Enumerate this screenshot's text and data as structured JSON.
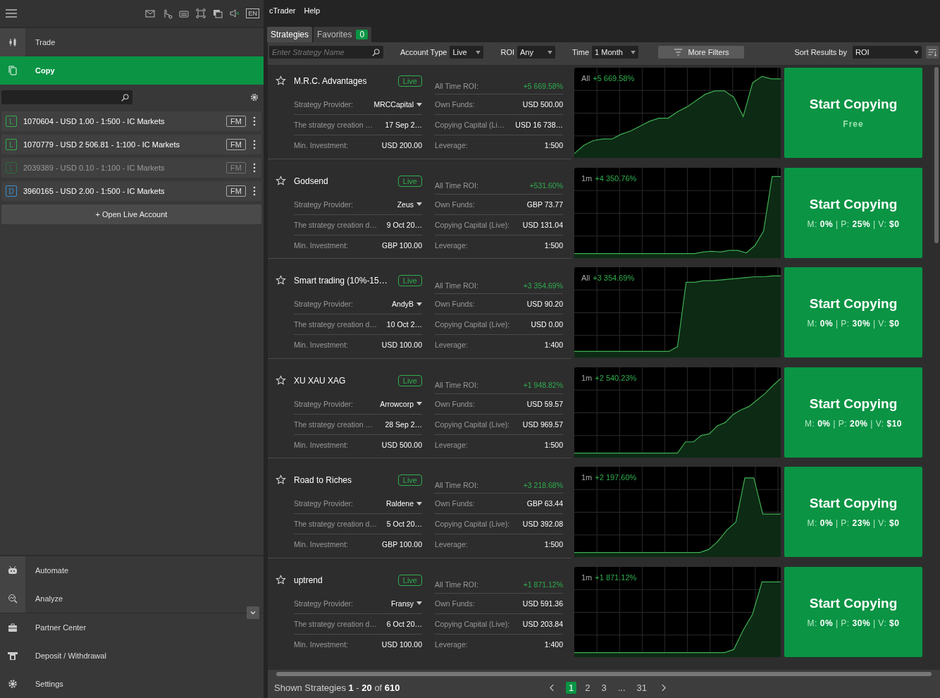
{
  "sidebar": {
    "top_nav": [
      {
        "label": "Trade",
        "selected": false
      },
      {
        "label": "Copy",
        "selected": true
      }
    ],
    "accounts": [
      {
        "type": "L",
        "color": "#2fae4e",
        "label": "1070604 - USD 1.00 - 1:500 - IC Markets",
        "badge": "FM",
        "disabled": false
      },
      {
        "type": "L",
        "color": "#2fae4e",
        "label": "1070779 - USD 2 506.81 - 1:100 - IC Markets",
        "badge": "FM",
        "disabled": false
      },
      {
        "type": "L",
        "color": "#2a6b3a",
        "label": "2039389 - USD 0.10 - 1:100 - IC Markets",
        "badge": "FM",
        "disabled": true
      },
      {
        "type": "D",
        "color": "#3a8fd0",
        "label": "3960165 - USD 2.00 - 1:500 - IC Markets",
        "badge": "FM",
        "disabled": false
      }
    ],
    "open_account": "+ Open Live Account",
    "bottom_nav": [
      {
        "label": "Automate",
        "selected": false
      },
      {
        "label": "Analyze",
        "selected": false
      },
      {
        "label": "Partner Center",
        "selected": false
      },
      {
        "label": "Deposit / Withdrawal",
        "selected": false
      },
      {
        "label": "Settings",
        "selected": false
      }
    ],
    "language": "EN"
  },
  "menu": [
    "cTrader",
    "Help"
  ],
  "tabs": [
    {
      "label": "Strategies",
      "selected": true
    },
    {
      "label": "Favorites",
      "selected": false,
      "count": "0"
    }
  ],
  "filters": {
    "search": {
      "placeholder": "Enter Strategy Name"
    },
    "selects": [
      {
        "label": "Account Type",
        "value": "Live"
      },
      {
        "label": "ROI",
        "value": "Any"
      },
      {
        "label": "Time",
        "value": "1 Month"
      }
    ],
    "more": "More Filters",
    "sort_label": "Sort Results by",
    "sort_value": "ROI"
  },
  "strategies": [
    {
      "name": "M.R.C. Advantages",
      "badge": "Live",
      "provider_label": "Strategy Provider:",
      "provider": "MRCCapital",
      "creation_label": "The strategy creation …",
      "creation": "17 Sep 2…",
      "min_label": "Min. Investment:",
      "min": "USD 200.00",
      "roi_label": "All Time ROI:",
      "roi": "+5 669.58%",
      "funds_label": "Own Funds:",
      "funds": "USD 500.00",
      "capital_label": "Copying Capital (Li…",
      "capital": "USD 16 738…",
      "leverage_label": "Leverage:",
      "leverage": "1:500",
      "period": "All",
      "period_roi": "+5 669.58%",
      "button": "Start Copying",
      "kind": "free",
      "fee": "Free"
    },
    {
      "name": "Godsend",
      "badge": "Live",
      "provider_label": "Strategy Provider:",
      "provider": "Zeus",
      "creation_label": "The strategy creation d…",
      "creation": "9 Oct 20…",
      "min_label": "Min. Investment:",
      "min": "GBP 100.00",
      "roi_label": "All Time ROI:",
      "roi": "+531.60%",
      "funds_label": "Own Funds:",
      "funds": "GBP 73.77",
      "capital_label": "Copying Capital (Live):",
      "capital": "USD 131.04",
      "leverage_label": "Leverage:",
      "leverage": "1:500",
      "period": "1m",
      "period_roi": "+4 350.76%",
      "button": "Start Copying",
      "kind": "fees",
      "fee": "M: **0%** | P: **25%** | V: **$0**"
    },
    {
      "name": "Smart trading (10%-15…",
      "badge": "Live",
      "provider_label": "Strategy Provider:",
      "provider": "AndyB",
      "creation_label": "The strategy creation d…",
      "creation": "10 Oct 2…",
      "min_label": "Min. Investment:",
      "min": "USD 100.00",
      "roi_label": "All Time ROI:",
      "roi": "+3 354.69%",
      "funds_label": "Own Funds:",
      "funds": "USD 90.20",
      "capital_label": "Copying Capital (Live):",
      "capital": "USD 0.00",
      "leverage_label": "Leverage:",
      "leverage": "1:400",
      "period": "All",
      "period_roi": "+3 354.69%",
      "button": "Start Copying",
      "kind": "fees",
      "fee": "M: **0%** | P: **30%** | V: **$0**"
    },
    {
      "name": "XU XAU XAG",
      "badge": "Live",
      "provider_label": "Strategy Provider:",
      "provider": "Arrowcorp",
      "creation_label": "The strategy creation …",
      "creation": "28 Sep 2…",
      "min_label": "Min. Investment:",
      "min": "USD 500.00",
      "roi_label": "All Time ROI:",
      "roi": "+1 948.82%",
      "funds_label": "Own Funds:",
      "funds": "USD 59.57",
      "capital_label": "Copying Capital (Live):",
      "capital": "USD 969.57",
      "leverage_label": "Leverage:",
      "leverage": "1:500",
      "period": "1m",
      "period_roi": "+2 540.23%",
      "button": "Start Copying",
      "kind": "fees",
      "fee": "M: **0%** | P: **20%** | V: **$10**"
    },
    {
      "name": "Road to Riches",
      "badge": "Live",
      "provider_label": "Strategy Provider:",
      "provider": "Raldene",
      "creation_label": "The strategy creation d…",
      "creation": "5 Oct 20…",
      "min_label": "Min. Investment:",
      "min": "GBP 100.00",
      "roi_label": "All Time ROI:",
      "roi": "+3 218.68%",
      "funds_label": "Own Funds:",
      "funds": "GBP 63.44",
      "capital_label": "Copying Capital (Live):",
      "capital": "USD 392.08",
      "leverage_label": "Leverage:",
      "leverage": "1:500",
      "period": "1m",
      "period_roi": "+2 197.60%",
      "button": "Start Copying",
      "kind": "fees",
      "fee": "M: **0%** | P: **23%** | V: **$0**"
    },
    {
      "name": "uptrend",
      "badge": "Live",
      "provider_label": "Strategy Provider:",
      "provider": "Fransy",
      "creation_label": "The strategy creation d…",
      "creation": "6 Oct 20…",
      "min_label": "Min. Investment:",
      "min": "USD 100.00",
      "roi_label": "All Time ROI:",
      "roi": "+1 871.12%",
      "funds_label": "Own Funds:",
      "funds": "USD 591.36",
      "capital_label": "Copying Capital (Live):",
      "capital": "USD 203.84",
      "leverage_label": "Leverage:",
      "leverage": "1:400",
      "period": "1m",
      "period_roi": "+1 871.12%",
      "button": "Start Copying",
      "kind": "fees",
      "fee": "M: **0%** | P: **30%** | V: **$0**"
    }
  ],
  "footer": {
    "shown": "Shown Strategies **1** - **20** of **610**",
    "pages": [
      {
        "label": "1",
        "selected": true
      },
      {
        "label": "2",
        "selected": false
      },
      {
        "label": "3",
        "selected": false
      },
      {
        "label": "...",
        "selected": false
      },
      {
        "label": "31",
        "selected": false
      }
    ]
  }
}
